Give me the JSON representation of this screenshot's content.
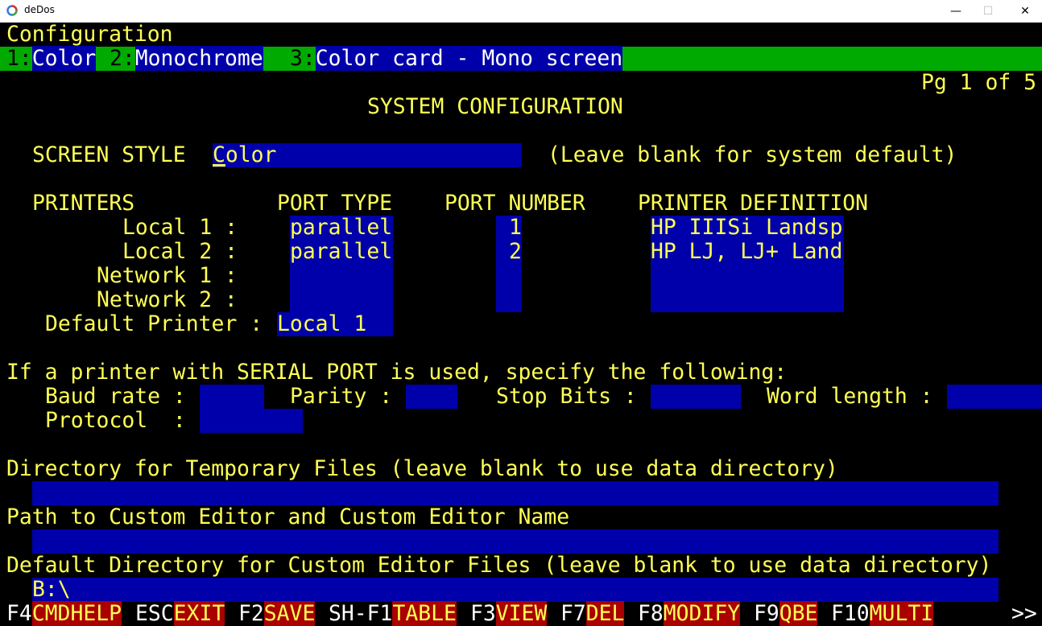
{
  "window": {
    "title": "deDos",
    "minimize_glyph": "—",
    "maximize_glyph": "☐",
    "close_glyph": "✕"
  },
  "screen": {
    "header": "Configuration",
    "menu": [
      {
        "key": "1:",
        "label": "Color"
      },
      {
        "key": "2:",
        "label": "Monochrome"
      },
      {
        "key": "3:",
        "label": "Color card - Mono screen"
      }
    ],
    "page_indicator": "Pg 1 of 5",
    "title": "SYSTEM CONFIGURATION",
    "screen_style": {
      "label": "SCREEN STYLE",
      "value": "Color",
      "hint": "(Leave blank for system default)"
    },
    "printers": {
      "headers": {
        "printers": "PRINTERS",
        "port_type": "PORT TYPE",
        "port_number": "PORT NUMBER",
        "definition": "PRINTER DEFINITION"
      },
      "rows": [
        {
          "label": "Local 1 :",
          "port_type": "parallel",
          "port_number": "1",
          "definition": "HP IIISi Landsp"
        },
        {
          "label": "Local 2 :",
          "port_type": "parallel",
          "port_number": "2",
          "definition": "HP LJ, LJ+ Land"
        },
        {
          "label": "Network 1 :",
          "port_type": "",
          "port_number": "",
          "definition": ""
        },
        {
          "label": "Network 2 :",
          "port_type": "",
          "port_number": "",
          "definition": ""
        }
      ],
      "default": {
        "label": "Default Printer :",
        "value": "Local 1"
      }
    },
    "serial": {
      "intro": "If a printer with SERIAL PORT is used, specify the following:",
      "baud_label": "Baud rate :",
      "baud_value": "",
      "parity_label": "Parity :",
      "parity_value": "",
      "stop_label": "Stop Bits :",
      "stop_value": "",
      "word_label": "Word length :",
      "word_value": "",
      "protocol_label": "Protocol  :",
      "protocol_value": ""
    },
    "temp_dir": {
      "label": "Directory for Temporary Files (leave blank to use data directory)",
      "value": ""
    },
    "editor_path": {
      "label": "Path to Custom Editor and Custom Editor Name",
      "value": ""
    },
    "editor_dir": {
      "label": "Default Directory for Custom Editor Files (leave blank to use data directory)",
      "value": "B:\\"
    },
    "function_keys": [
      {
        "key": "F4",
        "label": "CMDHELP"
      },
      {
        "key": "ESC",
        "label": "EXIT"
      },
      {
        "key": "F2",
        "label": "SAVE"
      },
      {
        "key": "SH-F1",
        "label": "TABLE"
      },
      {
        "key": "F3",
        "label": "VIEW"
      },
      {
        "key": "F7",
        "label": "DEL"
      },
      {
        "key": "F8",
        "label": "MODIFY"
      },
      {
        "key": "F9",
        "label": "QBE"
      },
      {
        "key": "F10",
        "label": "MULTI"
      }
    ],
    "more": ">>"
  },
  "colors": {
    "background": "#000000",
    "text": "#ffff55",
    "field": "#0000aa",
    "menu": "#00aa00",
    "fkey": "#aa0000"
  }
}
